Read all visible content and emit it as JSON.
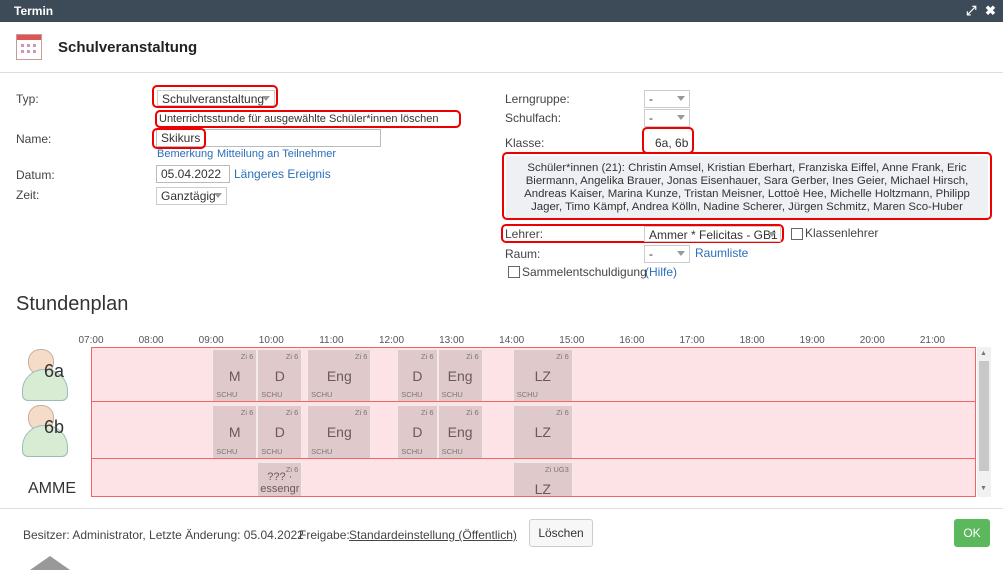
{
  "window": {
    "title": "Termin"
  },
  "header": {
    "title": "Schulveranstaltung"
  },
  "form": {
    "typ_label": "Typ:",
    "typ_value": "Schulveranstaltung",
    "delete_lesson_link": "Unterrichtsstunde für ausgewählte Schüler*innen löschen",
    "name_label": "Name:",
    "name_value": "Skikurs",
    "bemerkung_link": "Bemerkung",
    "mitteilung_link": "Mitteilung an Teilnehmer",
    "datum_label": "Datum:",
    "datum_value": "05.04.2022",
    "laengeres_link": "Längeres Ereignis",
    "zeit_label": "Zeit:",
    "zeit_value": "Ganztägig",
    "lerngruppe_label": "Lerngruppe:",
    "lerngruppe_value": "-",
    "schulfach_label": "Schulfach:",
    "schulfach_value": "-",
    "klasse_label": "Klasse:",
    "klasse_value": "6a, 6b",
    "students_text": "Schüler*innen (21): Christin Amsel, Kristian Eberhart, Franziska Eiffel, Anne Frank, Eric Biermann, Angelika Brauer, Jonas Eisenhauer, Sara Gerber, Ines Geier, Michael Hirsch, Andreas Kaiser, Marina Kunze, Tristan Meisner, Lottoè Hee, Michelle Holtzmann, Philipp Jager, Timo Kämpf, Andrea Kölln, Nadine Scherer, Jürgen Schmitz, Maren Sco-Huber",
    "lehrer_label": "Lehrer:",
    "lehrer_value": "Ammer * Felicitas - GB1",
    "klassenlehrer_label": "Klassenlehrer",
    "raum_label": "Raum:",
    "raum_value": "-",
    "raumliste_link": "Raumliste",
    "sammel_label": "Sammelentschuldigung",
    "hilfe_link": "(Hilfe)"
  },
  "stundenplan": {
    "title": "Stundenplan",
    "hours": [
      "07:00",
      "08:00",
      "09:00",
      "10:00",
      "11:00",
      "12:00",
      "13:00",
      "14:00",
      "15:00",
      "16:00",
      "17:00",
      "18:00",
      "19:00",
      "20:00",
      "21:00"
    ],
    "rows": [
      {
        "label": "6a",
        "blocks": [
          {
            "start": 9.0,
            "end": 9.75,
            "subject": "M",
            "room": "Zi 6",
            "group": "SCHU"
          },
          {
            "start": 9.75,
            "end": 10.5,
            "subject": "D",
            "room": "Zi 6",
            "group": "SCHU"
          },
          {
            "start": 10.58,
            "end": 11.65,
            "subject": "Eng",
            "room": "Zi 6",
            "group": "SCHU"
          },
          {
            "start": 12.08,
            "end": 12.75,
            "subject": "D",
            "room": "Zi 6",
            "group": "SCHU"
          },
          {
            "start": 12.75,
            "end": 13.5,
            "subject": "Eng",
            "room": "Zi 6",
            "group": "SCHU"
          },
          {
            "start": 14.0,
            "end": 15.0,
            "subject": "LZ",
            "room": "Zi 6",
            "group": "SCHU"
          }
        ]
      },
      {
        "label": "6b",
        "blocks": [
          {
            "start": 9.0,
            "end": 9.75,
            "subject": "M",
            "room": "Zi 6",
            "group": "SCHU"
          },
          {
            "start": 9.75,
            "end": 10.5,
            "subject": "D",
            "room": "Zi 6",
            "group": "SCHU"
          },
          {
            "start": 10.58,
            "end": 11.65,
            "subject": "Eng",
            "room": "Zi 6",
            "group": "SCHU"
          },
          {
            "start": 12.08,
            "end": 12.75,
            "subject": "D",
            "room": "Zi 6",
            "group": "SCHU"
          },
          {
            "start": 12.75,
            "end": 13.5,
            "subject": "Eng",
            "room": "Zi 6",
            "group": "SCHU"
          },
          {
            "start": 14.0,
            "end": 15.0,
            "subject": "LZ",
            "room": "Zi 6",
            "group": ""
          }
        ]
      },
      {
        "label": "AMME",
        "blocks": [
          {
            "start": 9.75,
            "end": 10.5,
            "subject": "??? · essengr",
            "room": "Zi 6",
            "group": ""
          },
          {
            "start": 14.0,
            "end": 15.0,
            "subject": "LZ",
            "room": "Zi UG3",
            "group": ""
          }
        ]
      }
    ]
  },
  "footer": {
    "besitzer": "Besitzer: Administrator, Letzte Änderung: 05.04.2022",
    "freigabe_label": "Freigabe:",
    "freigabe_link": "Standardeinstellung (Öffentlich)",
    "delete_button": "Löschen",
    "ok_button": "OK"
  },
  "colors": {
    "titlebar": "#3d4a57",
    "highlight": "#e00000",
    "ok": "#5cb85c",
    "grid_bg": "#fde3e6",
    "block": "#e0c9cb"
  }
}
